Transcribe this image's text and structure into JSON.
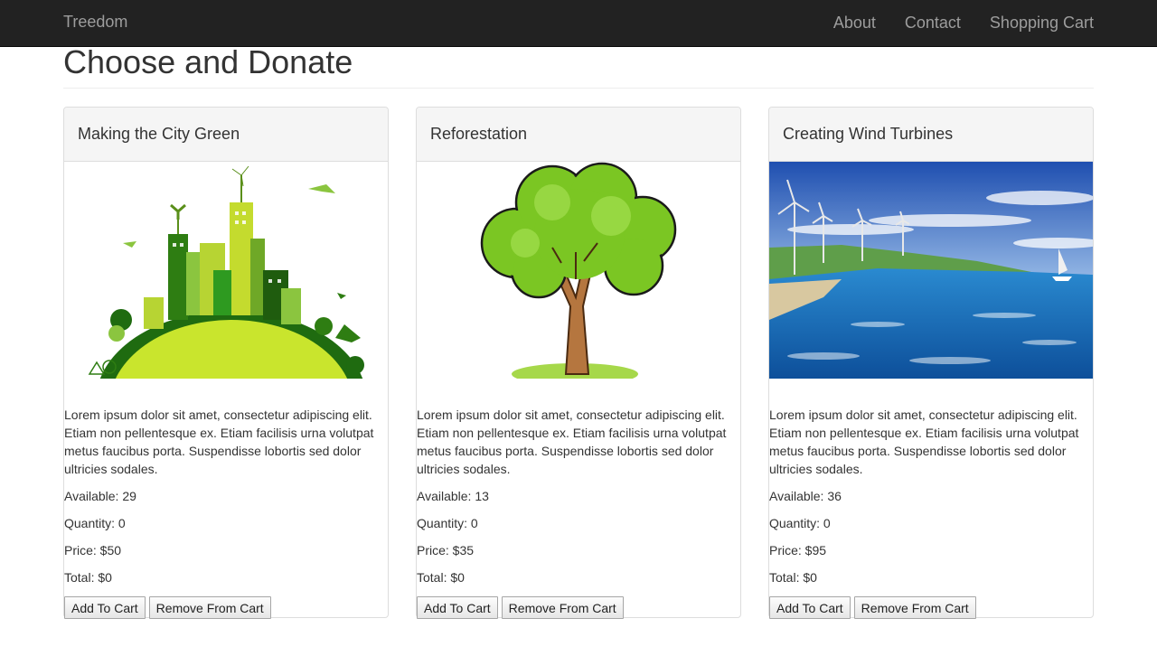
{
  "navbar": {
    "brand": "Treedom",
    "links": [
      "About",
      "Contact",
      "Shopping Cart"
    ]
  },
  "page": {
    "title": "Choose and Donate"
  },
  "buttons": {
    "add": "Add To Cart",
    "remove": "Remove From Cart"
  },
  "products": [
    {
      "title": "Making the City Green",
      "image": "green-city-illustration",
      "description": "Lorem ipsum dolor sit amet, consectetur adipiscing elit. Etiam non pellentesque ex. Etiam facilisis urna volutpat metus faucibus porta. Suspendisse lobortis sed dolor ultricies sodales.",
      "available": "Available: 29",
      "quantity": "Quantity: 0",
      "price": "Price: $50",
      "total": "Total: $0"
    },
    {
      "title": "Reforestation",
      "image": "tree-illustration",
      "description": "Lorem ipsum dolor sit amet, consectetur adipiscing elit. Etiam non pellentesque ex. Etiam facilisis urna volutpat metus faucibus porta. Suspendisse lobortis sed dolor ultricies sodales.",
      "available": "Available: 13",
      "quantity": "Quantity: 0",
      "price": "Price: $35",
      "total": "Total: $0"
    },
    {
      "title": "Creating Wind Turbines",
      "image": "wind-turbines-photo",
      "description": "Lorem ipsum dolor sit amet, consectetur adipiscing elit. Etiam non pellentesque ex. Etiam facilisis urna volutpat metus faucibus porta. Suspendisse lobortis sed dolor ultricies sodales.",
      "available": "Available: 36",
      "quantity": "Quantity: 0",
      "price": "Price: $95",
      "total": "Total: $0"
    }
  ]
}
